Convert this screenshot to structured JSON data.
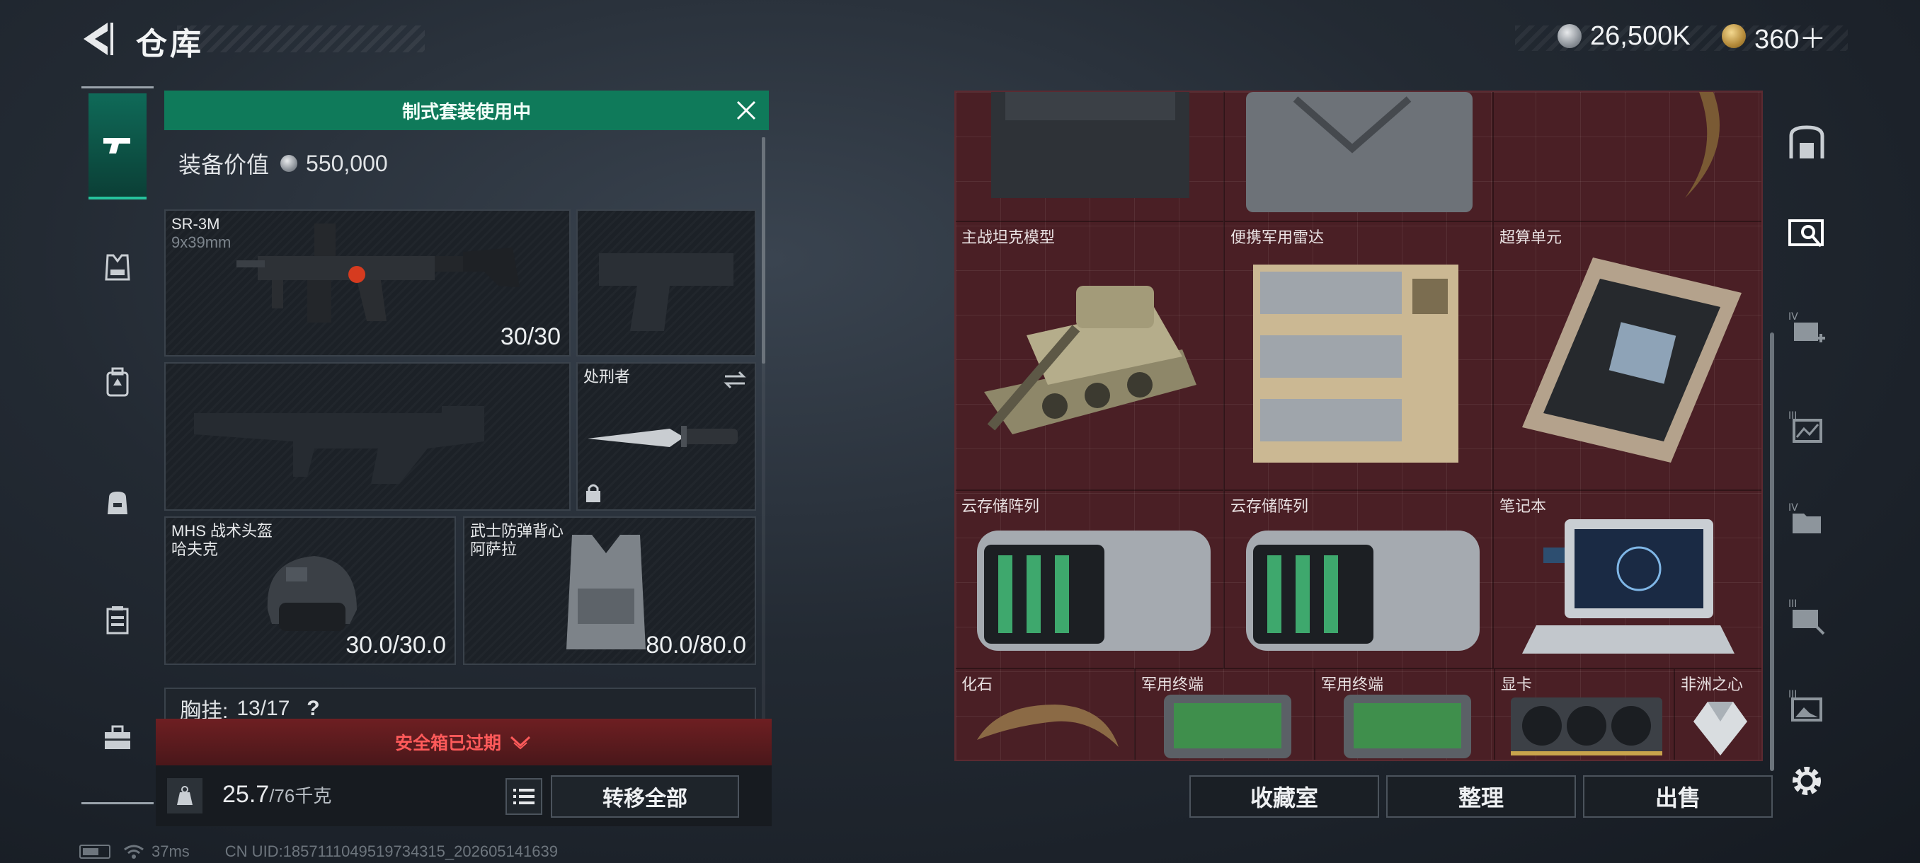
{
  "header": {
    "title": "仓库",
    "currency_silver": "26,500K",
    "currency_gold": "360＋"
  },
  "left_nav": {
    "items": [
      "weapon-icon",
      "vest-icon",
      "backpack-icon",
      "bag-icon",
      "chest-rig-icon",
      "toolbox-icon"
    ],
    "active_index": 0
  },
  "loadout": {
    "banner": "制式套装使用中",
    "equip_value_label": "装备价值",
    "equip_value": "550,000",
    "primary": {
      "name": "SR-3M",
      "caliber": "9x39mm",
      "ammo": "30/30"
    },
    "melee": {
      "name": "处刑者"
    },
    "helmet": {
      "name": "MHS 战术头盔",
      "sub": "哈夫克",
      "durability": "30.0/30.0"
    },
    "armor": {
      "name": "武士防弹背心",
      "sub": "阿萨拉",
      "durability": "80.0/80.0"
    },
    "chest_rig": {
      "label": "胸挂:",
      "value": "13/17",
      "help": "?"
    },
    "safebox_status": "安全箱已过期",
    "weight": "25.7",
    "weight_max": "/76千克",
    "transfer_all": "转移全部"
  },
  "storage": {
    "items": [
      {
        "label": "主战坦克模型",
        "icon": "tank-icon"
      },
      {
        "label": "便携军用雷达",
        "icon": "radar-icon"
      },
      {
        "label": "超算单元",
        "icon": "supercomputer-icon"
      },
      {
        "label": "云存储阵列",
        "icon": "storage-array-icon"
      },
      {
        "label": "云存储阵列",
        "icon": "storage-array-icon"
      },
      {
        "label": "笔记本",
        "icon": "laptop-icon"
      },
      {
        "label": "化石",
        "icon": "fossil-icon"
      },
      {
        "label": "军用终端",
        "icon": "terminal-icon"
      },
      {
        "label": "军用终端",
        "icon": "terminal-icon"
      },
      {
        "label": "显卡",
        "icon": "gpu-icon"
      },
      {
        "label": "非洲之心",
        "icon": "diamond-icon"
      }
    ],
    "buttons": {
      "collection": "收藏室",
      "sort": "整理",
      "sell": "出售"
    },
    "accent_color": "#4a1f25"
  },
  "right_nav": {
    "items": [
      "safe-icon",
      "filter-screen-icon",
      "level4-add-icon",
      "level3-chart-icon",
      "level4-folder-icon",
      "level3-tag-icon",
      "level3-image-icon",
      "settings-icon"
    ]
  },
  "status_bar": {
    "ping": "37ms",
    "uid": "CN UID:1857111049519734315_202605141639"
  }
}
